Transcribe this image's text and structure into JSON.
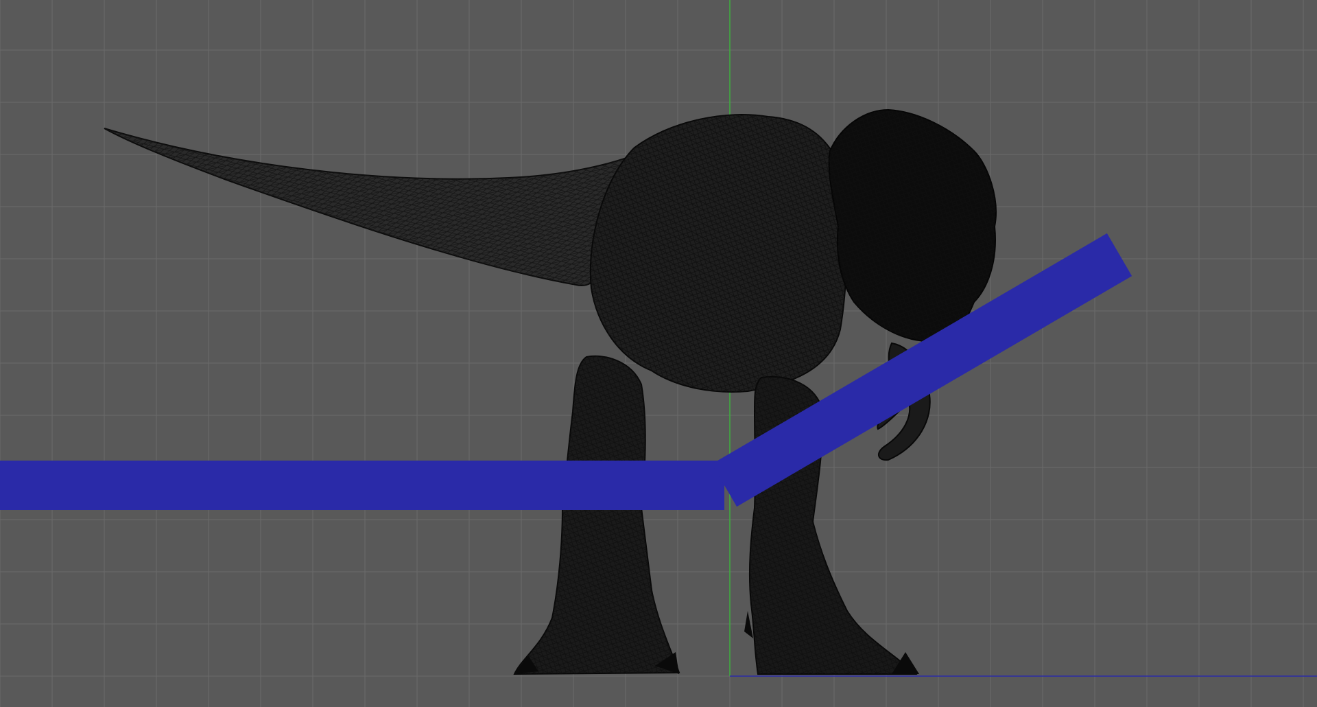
{
  "viewport": {
    "view": "front",
    "shading": "wireframe",
    "grid": true,
    "model": "tyrannosaurus-rex"
  },
  "colors": {
    "background": "#595959",
    "grid_line": "#6a6a6a",
    "axis_y": "#3fae3f",
    "axis_x": "#2a2aa8",
    "wire_dark": "#0a0a0a",
    "wire_mid": "#1c1c1c"
  }
}
